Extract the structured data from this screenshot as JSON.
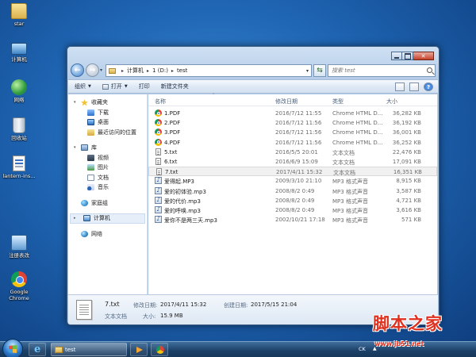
{
  "desktop": {
    "icons": [
      {
        "label": "star",
        "icon": "folder-icon"
      },
      {
        "label": "计算机",
        "icon": "computer-icon"
      },
      {
        "label": "网络",
        "icon": "network-icon"
      },
      {
        "label": "回收站",
        "icon": "recycle-bin-icon"
      },
      {
        "label": "lantern-ins...",
        "icon": "document-icon"
      },
      {
        "label": "注册表改",
        "icon": "tool-icon"
      },
      {
        "label": "Google Chrome",
        "icon": "chrome-icon"
      }
    ]
  },
  "window": {
    "address": {
      "crumbs": [
        "计算机",
        "1 (D:)",
        "test"
      ]
    },
    "search": {
      "placeholder": "搜索 test"
    },
    "toolbar": {
      "organize": "组织",
      "open": "打开",
      "print": "打印",
      "new_folder": "新建文件夹"
    },
    "nav_pane": {
      "favorites": "收藏夹",
      "downloads": "下载",
      "desktop": "桌面",
      "recent": "最近访问的位置",
      "libraries": "库",
      "videos": "视频",
      "pictures": "图片",
      "documents": "文档",
      "music": "音乐",
      "homegroup": "家庭组",
      "computer": "计算机",
      "network": "网络"
    },
    "columns": {
      "name": "名称",
      "date": "修改日期",
      "type": "类型",
      "size": "大小"
    },
    "files": [
      {
        "name": "1.PDF",
        "date": "2016/7/12 11:55",
        "type": "Chrome HTML D...",
        "size": "36,282 KB",
        "icon": "chrome-icon"
      },
      {
        "name": "2.PDF",
        "date": "2016/7/12 11:56",
        "type": "Chrome HTML D...",
        "size": "36,192 KB",
        "icon": "chrome-icon"
      },
      {
        "name": "3.PDF",
        "date": "2016/7/12 11:56",
        "type": "Chrome HTML D...",
        "size": "36,001 KB",
        "icon": "chrome-icon"
      },
      {
        "name": "4.PDF",
        "date": "2016/7/12 11:56",
        "type": "Chrome HTML D...",
        "size": "36,252 KB",
        "icon": "chrome-icon"
      },
      {
        "name": "5.txt",
        "date": "2016/5/5 20:01",
        "type": "文本文档",
        "size": "22,476 KB",
        "icon": "text-file-icon"
      },
      {
        "name": "6.txt",
        "date": "2016/6/9 15:09",
        "type": "文本文档",
        "size": "17,091 KB",
        "icon": "text-file-icon"
      },
      {
        "name": "7.txt",
        "date": "2017/4/11 15:32",
        "type": "文本文档",
        "size": "16,351 KB",
        "icon": "text-file-icon",
        "selected": true
      },
      {
        "name": "爱得起.MP3",
        "date": "2009/3/10 21:10",
        "type": "MP3 格式声音",
        "size": "8,915 KB",
        "icon": "audio-file-icon"
      },
      {
        "name": "爱的初体验.mp3",
        "date": "2008/8/2 0:49",
        "type": "MP3 格式声音",
        "size": "3,587 KB",
        "icon": "audio-file-icon"
      },
      {
        "name": "爱的代价.mp3",
        "date": "2008/8/2 0:49",
        "type": "MP3 格式声音",
        "size": "4,721 KB",
        "icon": "audio-file-icon"
      },
      {
        "name": "爱的呼唤.mp3",
        "date": "2008/8/2 0:49",
        "type": "MP3 格式声音",
        "size": "3,616 KB",
        "icon": "audio-file-icon"
      },
      {
        "name": "爱你不是两三天.mp3",
        "date": "2002/10/21 17:18",
        "type": "MP3 格式声音",
        "size": "571 KB",
        "icon": "audio-file-icon"
      }
    ],
    "details": {
      "name": "7.txt",
      "kind": "文本文档",
      "modified_label": "修改日期:",
      "modified_value": "2017/4/11 15:32",
      "created_label": "创建日期:",
      "created_value": "2017/5/15 21:04",
      "size_label": "大小:",
      "size_value": "15.9 MB"
    }
  },
  "taskbar": {
    "explorer_label": "test",
    "lang": "CK"
  },
  "watermark": {
    "title": "脚本之家",
    "url": "www.jb51.net"
  },
  "colors": {
    "desktop_bg": "#1f66b4",
    "window_frame": "#b5cde8",
    "watermark": "#e03020"
  }
}
